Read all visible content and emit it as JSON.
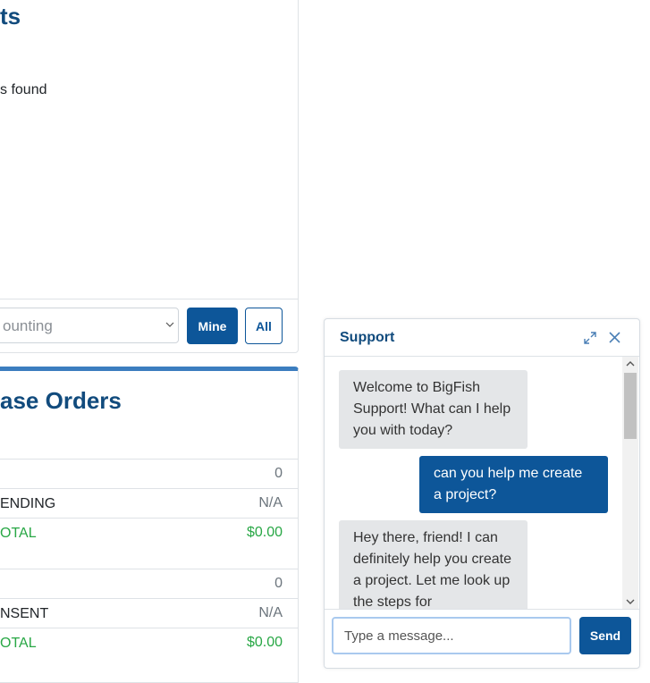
{
  "projects": {
    "title": "ts",
    "empty_message": "s found",
    "filter_select_value": "ounting",
    "mine_label": "Mine",
    "all_label": "All"
  },
  "purchase_orders": {
    "title": "ase Orders",
    "rows": [
      {
        "label": "",
        "value": "0"
      },
      {
        "label": "ENDING",
        "value": "N/A"
      },
      {
        "label": "OTAL",
        "value": "$0.00"
      },
      {
        "label": "",
        "value": "0"
      },
      {
        "label": "NSENT",
        "value": "N/A"
      },
      {
        "label": "OTAL",
        "value": "$0.00"
      }
    ]
  },
  "chat": {
    "title": "Support",
    "messages": [
      {
        "from": "bot",
        "text": "Welcome to BigFish Support! What can I help you with today?"
      },
      {
        "from": "user",
        "text": "can you help me create a project?"
      },
      {
        "from": "bot",
        "text": "Hey there, friend! I can definitely help you create a project. Let me look up the steps for"
      }
    ],
    "input_placeholder": "Type a message...",
    "send_label": "Send",
    "icons": {
      "expand": "expand-icon",
      "close": "close-icon"
    }
  },
  "colors": {
    "primary": "#0d5699",
    "heading": "#114b7d",
    "success": "#28a745",
    "accent_border": "#3b7dbf"
  }
}
